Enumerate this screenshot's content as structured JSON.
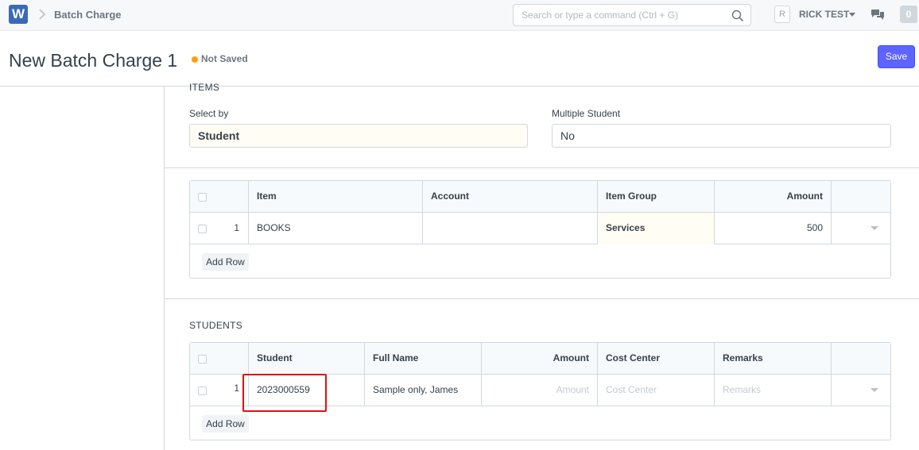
{
  "navbar": {
    "logo_letter": "W",
    "breadcrumb": "Batch Charge",
    "search_placeholder": "Search or type a command (Ctrl + G)",
    "avatar_letter": "R",
    "user_name": "RICK TEST",
    "notification_count": "0"
  },
  "page_head": {
    "title": "New Batch Charge 1",
    "status": "Not Saved",
    "save_label": "Save"
  },
  "form": {
    "items_section_label": "ITEMS",
    "select_by_label": "Select by",
    "select_by_value": "Student",
    "multiple_student_label": "Multiple Student",
    "multiple_student_value": "No",
    "items_grid": {
      "headers": [
        "Item",
        "Account",
        "Item Group",
        "Amount"
      ],
      "rows": [
        {
          "idx": "1",
          "item": "BOOKS",
          "account": "",
          "item_group": "Services",
          "amount": "500"
        }
      ],
      "add_row_label": "Add Row"
    },
    "students_section_label": "STUDENTS",
    "students_grid": {
      "headers": [
        "Student",
        "Full Name",
        "Amount",
        "Cost Center",
        "Remarks"
      ],
      "rows": [
        {
          "idx": "1",
          "student": "2023000559",
          "full_name": "Sample only, James",
          "amount_placeholder": "Amount",
          "cost_center_placeholder": "Cost Center",
          "remarks_placeholder": "Remarks"
        }
      ],
      "add_row_label": "Add Row"
    }
  },
  "colors": {
    "primary": "#5e64ff",
    "not_saved_indicator": "#ffa00a",
    "highlight_box": "#e01111",
    "logo": "#3a6ab5"
  }
}
